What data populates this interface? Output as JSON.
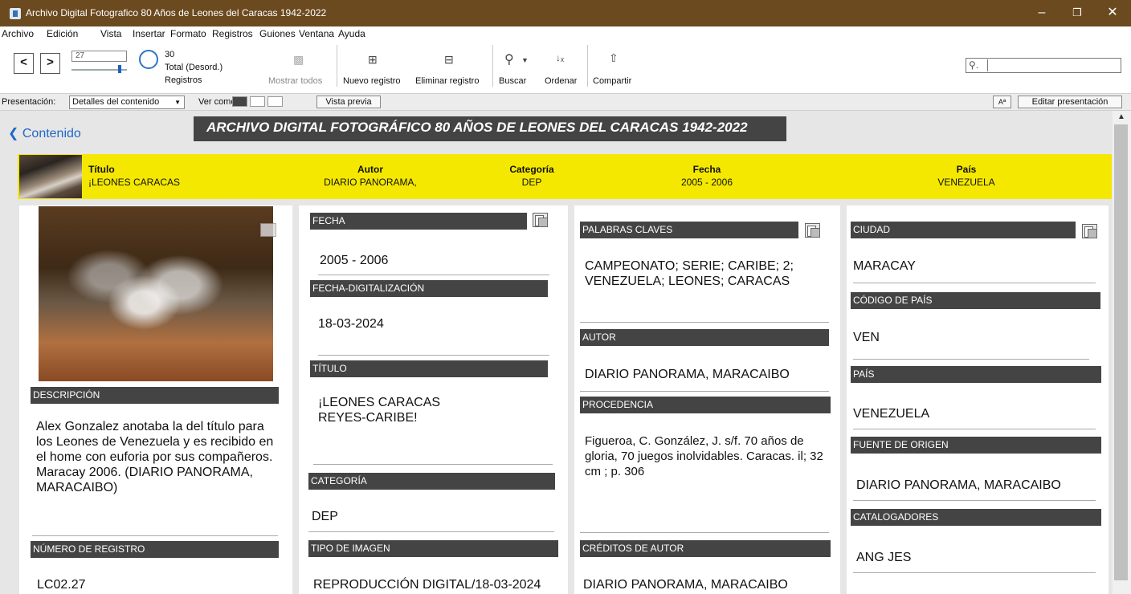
{
  "window": {
    "title": "Archivo Digital Fotografico 80 Años de Leones del Caracas 1942-2022"
  },
  "menu": [
    "Archivo",
    "Edición",
    "Vista",
    "Insertar",
    "Formato",
    "Registros",
    "Guiones",
    "Ventana",
    "Ayuda"
  ],
  "toolbar": {
    "record_current": "27",
    "record_total": "30",
    "total_status": "Total (Desord.)",
    "records_label": "Registros",
    "show_all": "Mostrar todos",
    "new_record": "Nuevo registro",
    "delete_record": "Eliminar registro",
    "find": "Buscar",
    "sort": "Ordenar",
    "share": "Compartir"
  },
  "layoutbar": {
    "layout_label": "Presentación:",
    "layout_value": "Detalles del contenido",
    "view_as": "Ver como:",
    "preview": "Vista previa",
    "edit_layout": "Editar presentación",
    "aa": "Aª"
  },
  "header": {
    "back_link": "Contenido",
    "title": "ARCHIVO DIGITAL FOTOGRÁFICO 80 AÑOS DE LEONES DEL CARACAS 1942-2022"
  },
  "summary": {
    "titulo_label": "Título",
    "titulo": "¡LEONES CARACAS",
    "autor_label": "Autor",
    "autor": "DIARIO PANORAMA,",
    "categoria_label": "Categoría",
    "categoria": "DEP",
    "fecha_label": "Fecha",
    "fecha": "2005 - 2006",
    "pais_label": "País",
    "pais": "VENEZUELA"
  },
  "col1": {
    "descripcion_label": "DESCRIPCIÓN",
    "descripcion": "Alex Gonzalez anotaba la del título para los Leones de Venezuela y es recibido en el home con euforia por sus compañeros. Maracay 2006. (DIARIO PANORAMA, MARACAIBO)",
    "numero_label": "NÚMERO DE REGISTRO",
    "numero": "LC02.27"
  },
  "col2": {
    "fecha_label": "FECHA",
    "fecha": "2005 - 2006",
    "fecha_dig_label": "FECHA-DIGITALIZACIÓN",
    "fecha_dig": "18-03-2024",
    "titulo_label": "TÍTULO",
    "titulo": "¡LEONES CARACAS REYES-CARIBE!",
    "categoria_label": "CATEGORÍA",
    "categoria": "DEP",
    "tipo_label": "TIPO DE IMAGEN",
    "tipo": "REPRODUCCIÓN DIGITAL/18-03-2024"
  },
  "col3": {
    "palabras_label": "PALABRAS CLAVES",
    "palabras": "CAMPEONATO; SERIE; CARIBE; 2; VENEZUELA; LEONES; CARACAS",
    "autor_label": "AUTOR",
    "autor": "DIARIO PANORAMA, MARACAIBO",
    "procedencia_label": "PROCEDENCIA",
    "procedencia": "Figueroa, C. González, J. s/f. 70 años de gloria, 70 juegos inolvidables. Caracas. il; 32 cm ; p. 306",
    "creditos_label": "CRÉDITOS DE AUTOR",
    "creditos": "DIARIO PANORAMA, MARACAIBO"
  },
  "col4": {
    "ciudad_label": "CIUDAD",
    "ciudad": "MARACAY",
    "codigo_label": "CÓDIGO DE PAÍS",
    "codigo": "VEN",
    "pais_label": "PAÍS",
    "pais": "VENEZUELA",
    "fuente_label": "FUENTE DE ORIGEN",
    "fuente": "DIARIO PANORAMA, MARACAIBO",
    "catalogadores_label": "CATALOGADORES",
    "catalogadores": "ANG JES"
  }
}
